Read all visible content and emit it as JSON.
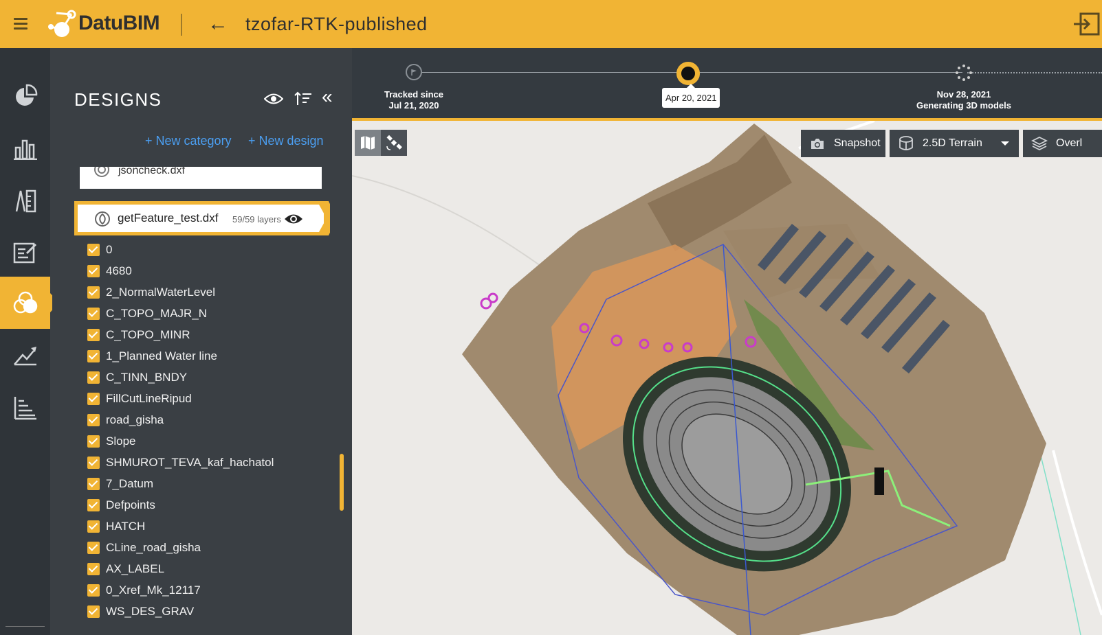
{
  "app": {
    "logo_text": "DatuBIM",
    "project_title": "tzofar-RTK-published",
    "accent_color": "#f1b434"
  },
  "rail": {
    "items": [
      {
        "icon": "pie-chart-icon"
      },
      {
        "icon": "bar-chart-icon"
      },
      {
        "icon": "survey-tools-icon"
      },
      {
        "icon": "report-edit-icon"
      },
      {
        "icon": "designs-layers-icon",
        "active": true
      },
      {
        "icon": "measure-draw-icon"
      },
      {
        "icon": "list-chart-icon"
      }
    ]
  },
  "panel": {
    "title": "DESIGNS",
    "new_category": "+ New category",
    "new_design": "+ New design",
    "files": [
      {
        "name": "jsoncheck.dxf"
      }
    ],
    "active_file": {
      "name": "getFeature_test.dxf",
      "layer_count": "59/59 layers"
    },
    "layers": [
      "0",
      "4680",
      "2_NormalWaterLevel",
      "C_TOPO_MAJR_N",
      "C_TOPO_MINR",
      "1_Planned Water line",
      "C_TINN_BNDY",
      "FillCutLineRipud",
      "road_gisha",
      "Slope",
      "SHMUROT_TEVA_kaf_hachatol",
      "7_Datum",
      "Defpoints",
      "HATCH",
      "CLine_road_gisha",
      "AX_LABEL",
      "0_Xref_Mk_12117",
      "WS_DES_GRAV"
    ]
  },
  "timeline": {
    "start_label_1": "Tracked since",
    "start_label_2": "Jul 21, 2020",
    "current_date": "Apr 20, 2021",
    "end_label_1": "Nov 28, 2021",
    "end_label_2": "Generating 3D models"
  },
  "map": {
    "snapshot_label": "Snapshot",
    "terrain_label": "2.5D Terrain",
    "overlay_label": "Overl"
  }
}
